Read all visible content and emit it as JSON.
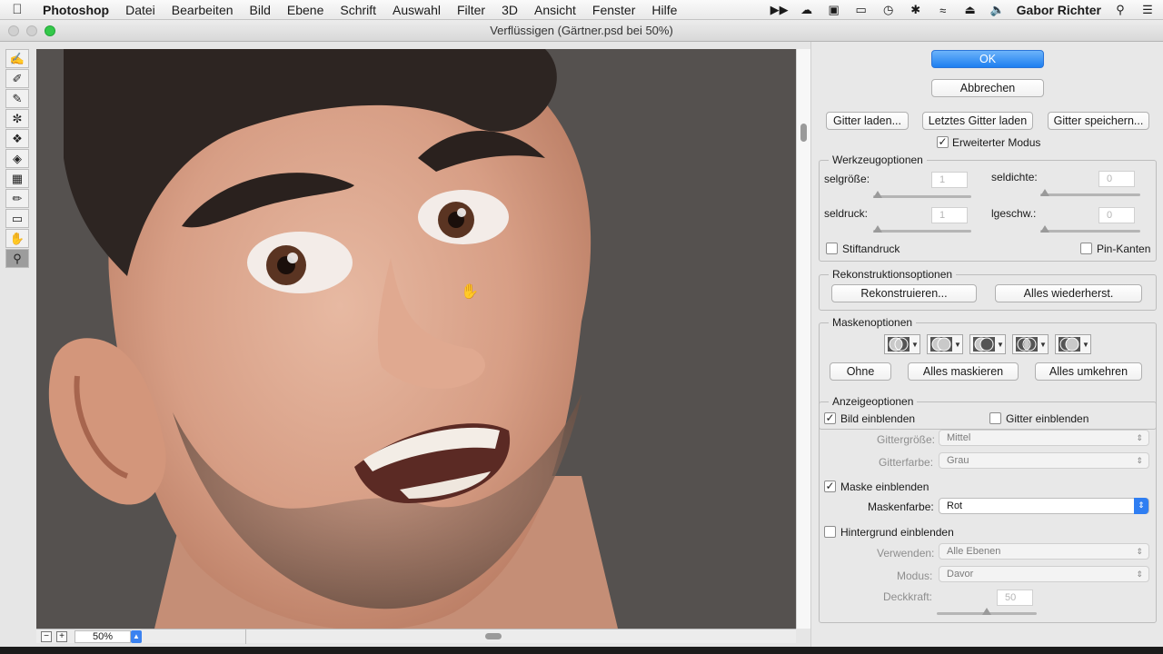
{
  "menubar": {
    "apple": "",
    "app": "Photoshop",
    "items": [
      "Datei",
      "Bearbeiten",
      "Bild",
      "Ebene",
      "Schrift",
      "Auswahl",
      "Filter",
      "3D",
      "Ansicht",
      "Fenster",
      "Hilfe"
    ],
    "user": "Gabor Richter",
    "status_icons": [
      "fast-forward-icon",
      "cloud-icon",
      "creative-cloud-icon",
      "airplay-icon",
      "time-machine-icon",
      "bluetooth-icon",
      "wifi-icon",
      "eject-icon",
      "volume-icon",
      "search-icon",
      "list-icon"
    ]
  },
  "window": {
    "title": "Verflüssigen (Gärtner.psd bei 50%)"
  },
  "tools": [
    "forward-warp-tool-icon",
    "reconstruct-tool-icon",
    "smooth-tool-icon",
    "twirl-tool-icon",
    "pucker-tool-icon",
    "bloat-tool-icon",
    "push-left-tool-icon",
    "freeze-mask-tool-icon",
    "thaw-mask-tool-icon",
    "hand-tool-icon",
    "zoom-tool-icon"
  ],
  "status": {
    "minus": "−",
    "plus": "+",
    "zoom": "50%"
  },
  "buttons": {
    "ok": "OK",
    "cancel": "Abbrechen",
    "load_mesh": "Gitter laden...",
    "load_last_mesh": "Letztes Gitter laden",
    "save_mesh": "Gitter speichern..."
  },
  "advanced_mode": {
    "label": "Erweiterter Modus",
    "checked": "✓"
  },
  "tool_options": {
    "title": "Werkzeugoptionen",
    "brush_size_label": "selgröße:",
    "brush_size_value": "1",
    "brush_density_label": "seldichte:",
    "brush_density_value": "0",
    "brush_pressure_label": "seldruck:",
    "brush_pressure_value": "1",
    "brush_rate_label": "lgeschw.:",
    "brush_rate_value": "0",
    "stylus_pressure": "Stiftandruck",
    "pin_edges": "Pin-Kanten"
  },
  "reconstruct_options": {
    "title": "Rekonstruktionsoptionen",
    "reconstruct": "Rekonstruieren...",
    "restore_all": "Alles wiederherst."
  },
  "mask_options": {
    "title": "Maskenoptionen",
    "none": "Ohne",
    "mask_all": "Alles maskieren",
    "invert_all": "Alles umkehren"
  },
  "view_options": {
    "title": "Anzeigeoptionen",
    "show_image": "Bild einblenden",
    "show_image_checked": "✓",
    "show_mesh": "Gitter einblenden",
    "mesh_size_label": "Gittergröße:",
    "mesh_size_value": "Mittel",
    "mesh_color_label": "Gitterfarbe:",
    "mesh_color_value": "Grau",
    "show_mask": "Maske einblenden",
    "show_mask_checked": "✓",
    "mask_color_label": "Maskenfarbe:",
    "mask_color_value": "Rot",
    "show_backdrop": "Hintergrund einblenden",
    "use_label": "Verwenden:",
    "use_value": "Alle Ebenen",
    "mode_label": "Modus:",
    "mode_value": "Davor",
    "opacity_label": "Deckkraft:",
    "opacity_value": "50"
  },
  "colors": {
    "accent": "#1e7ff0",
    "canvas_bg": "#55514f"
  }
}
